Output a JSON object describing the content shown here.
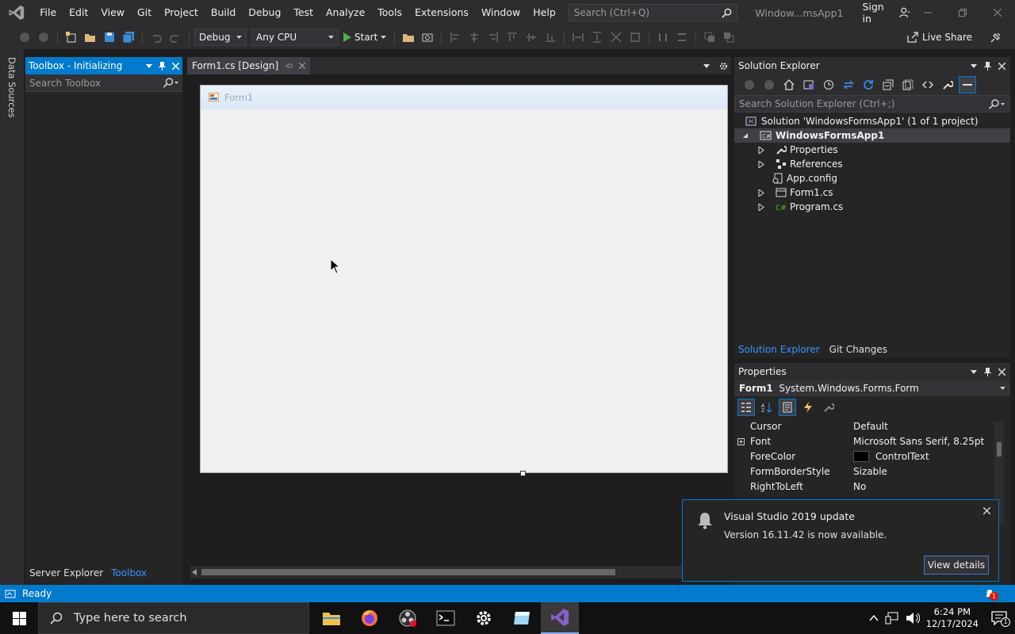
{
  "menu": [
    "File",
    "Edit",
    "View",
    "Git",
    "Project",
    "Build",
    "Debug",
    "Test",
    "Analyze",
    "Tools",
    "Extensions",
    "Window",
    "Help"
  ],
  "search": {
    "placeholder": "Search (Ctrl+Q)"
  },
  "window_title": "Window...msApp1",
  "signin_label": "Sign in",
  "toolbar": {
    "config": "Debug",
    "platform": "Any CPU",
    "start_label": "Start",
    "live_share_label": "Live Share"
  },
  "left_strip": {
    "data_sources": "Data Sources"
  },
  "toolbox": {
    "title": "Toolbox - Initializing",
    "search_placeholder": "Search Toolbox",
    "tabs": [
      "Server Explorer",
      "Toolbox"
    ]
  },
  "document": {
    "tab_label": "Form1.cs [Design]",
    "form_title": "Form1"
  },
  "solution_explorer": {
    "title": "Solution Explorer",
    "search_placeholder": "Search Solution Explorer (Ctrl+;)",
    "solution": "Solution 'WindowsFormsApp1' (1 of 1 project)",
    "project": "WindowsFormsApp1",
    "items": [
      "Properties",
      "References",
      "App.config",
      "Form1.cs",
      "Program.cs"
    ],
    "tabs": [
      "Solution Explorer",
      "Git Changes"
    ]
  },
  "properties": {
    "title": "Properties",
    "object_name": "Form1",
    "object_type": "System.Windows.Forms.Form",
    "rows": [
      {
        "name": "Cursor",
        "value": "Default"
      },
      {
        "name": "Font",
        "value": "Microsoft Sans Serif, 8.25pt"
      },
      {
        "name": "ForeColor",
        "value": "ControlText"
      },
      {
        "name": "FormBorderStyle",
        "value": "Sizable"
      },
      {
        "name": "RightToLeft",
        "value": "No"
      }
    ]
  },
  "notification": {
    "title": "Visual Studio 2019 update",
    "body": "Version 16.11.42 is now available.",
    "button": "View details"
  },
  "status": {
    "text": "Ready",
    "notif_count": "1"
  },
  "taskbar": {
    "search_placeholder": "Type here to search",
    "time": "6:24 PM",
    "date": "12/17/2024",
    "notif_count": "1"
  },
  "colors": {
    "accent": "#007acc",
    "chrome": "#2d2d30",
    "editor_bg": "#1e1e1e",
    "vs_purple": "#865fc5"
  }
}
